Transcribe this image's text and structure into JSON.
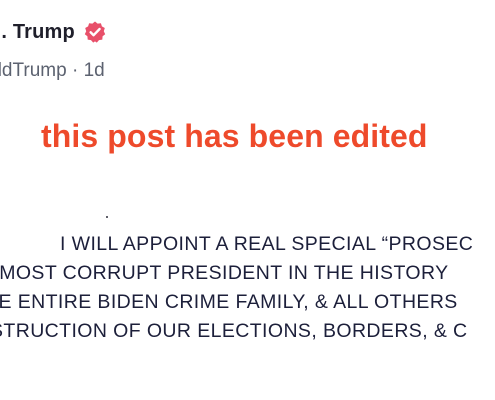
{
  "post": {
    "author": {
      "display_name": "J. Trump",
      "handle": "onaldTrump",
      "separator": "·",
      "age": "1d",
      "verified_icon": "verified-badge-icon"
    },
    "edited_notice": "this post has been edited",
    "statement_lines": [
      "I WILL APPOINT A REAL SPECIAL “PROSEC",
      "E MOST CORRUPT PRESIDENT IN THE HISTORY",
      "HE ENTIRE BIDEN CRIME FAMILY, & ALL OTHERS",
      "STRUCTION OF OUR ELECTIONS, BORDERS, & C"
    ]
  },
  "colors": {
    "accent_verified": "#e8506a",
    "edited_notice": "#ee4a2b",
    "text_dark": "#1c1f3a",
    "text_muted": "#5c6270",
    "background": "#ffffff"
  }
}
